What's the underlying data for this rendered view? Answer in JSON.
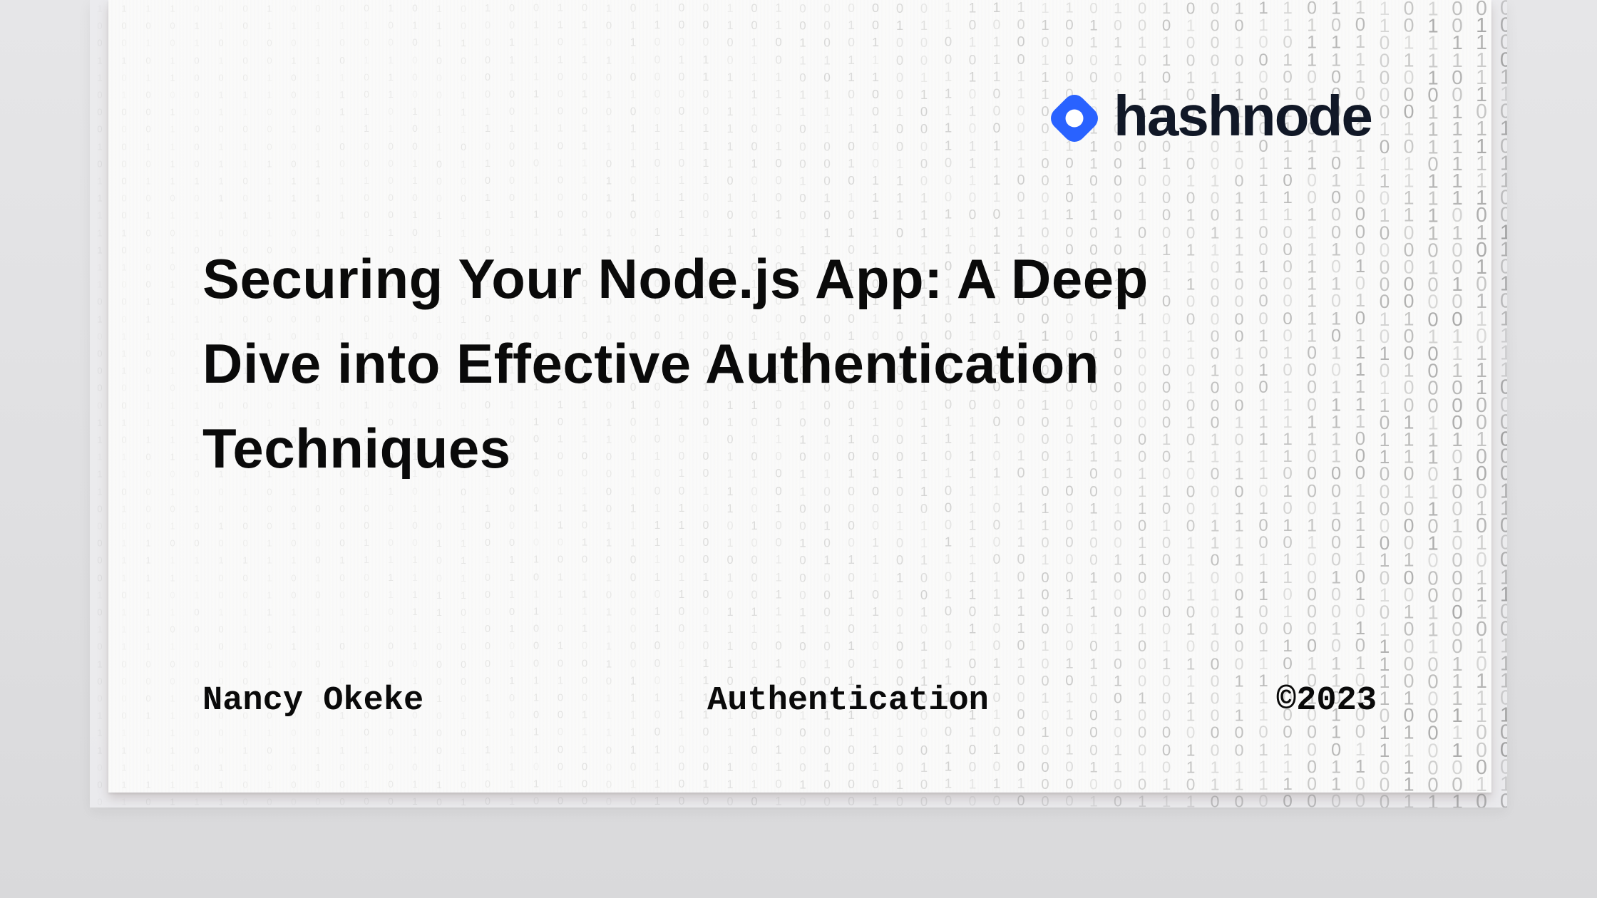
{
  "cover": {
    "brand": {
      "name": "hashnode",
      "icon": "hashnode-logo-icon",
      "accent_color": "#2962FF",
      "text_color": "#111827"
    },
    "title": "Securing Your Node.js App: A Deep Dive into Effective Authentication Techniques",
    "title_lines": [
      "Securing Your Node.js App: A Deep",
      "Dive into Effective Authentication",
      "Techniques"
    ],
    "footer": {
      "author": "Nancy Okeke",
      "category": "Authentication",
      "copyright": "©2023"
    },
    "background": {
      "pattern": "binary-digits",
      "digits": [
        "0",
        "1"
      ]
    }
  }
}
